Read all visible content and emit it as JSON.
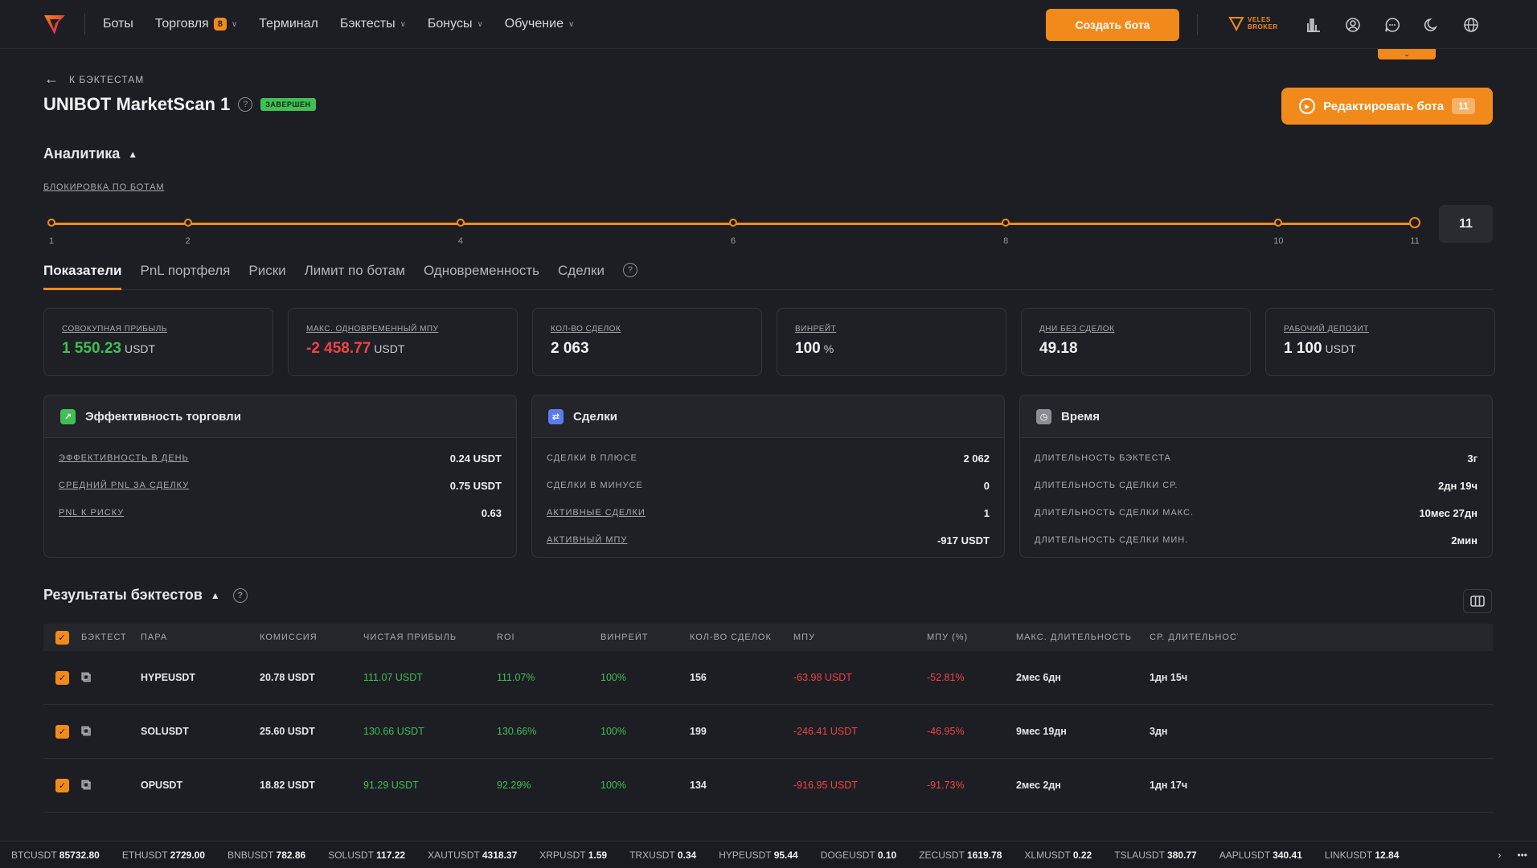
{
  "nav": {
    "items": [
      {
        "label": "Боты",
        "badge": "",
        "has_chevron": false
      },
      {
        "label": "Торговля",
        "badge": "8",
        "has_chevron": true
      },
      {
        "label": "Терминал",
        "badge": "",
        "has_chevron": false
      },
      {
        "label": "Бэктесты",
        "badge": "",
        "has_chevron": true
      },
      {
        "label": "Бонусы",
        "badge": "",
        "has_chevron": true
      },
      {
        "label": "Обучение",
        "badge": "",
        "has_chevron": true
      }
    ],
    "create_bot": "Создать бота",
    "broker_line1": "VELES",
    "broker_line2": "BROKER"
  },
  "header": {
    "back_label": "К БЭКТЕСТАМ",
    "title": "UNIBOT MarketScan 1",
    "status": "ЗАВЕРШЕН",
    "edit_button": "Редактировать бота",
    "edit_count": "11"
  },
  "analytics": {
    "title": "Аналитика",
    "block_link": "БЛОКИРОВКА ПО БОТАМ",
    "slider": {
      "min": 1,
      "max": 11,
      "value": 11,
      "ticks": [
        "1",
        "2",
        "4",
        "6",
        "8",
        "10",
        "11"
      ],
      "value_label": "11"
    }
  },
  "tabs": [
    {
      "label": "Показатели",
      "active": true
    },
    {
      "label": "PnL портфеля",
      "active": false
    },
    {
      "label": "Риски",
      "active": false
    },
    {
      "label": "Лимит по ботам",
      "active": false
    },
    {
      "label": "Одновременность",
      "active": false
    },
    {
      "label": "Сделки",
      "active": false
    }
  ],
  "stats": [
    {
      "label": "СОВОКУПНАЯ ПРИБЫЛЬ",
      "value": "1 550.23",
      "unit": "USDT",
      "tone": "pos"
    },
    {
      "label": "МАКС. ОДНОВРЕМЕННЫЙ МПУ",
      "value": "-2 458.77",
      "unit": "USDT",
      "tone": "neg"
    },
    {
      "label": "КОЛ-ВО СДЕЛОК",
      "value": "2 063",
      "unit": "",
      "tone": ""
    },
    {
      "label": "ВИНРЕЙТ",
      "value": "100",
      "unit": "%",
      "tone": ""
    },
    {
      "label": "ДНИ БЕЗ СДЕЛОК",
      "value": "49.18",
      "unit": "",
      "tone": ""
    },
    {
      "label": "РАБОЧИЙ ДЕПОЗИТ",
      "value": "1 100",
      "unit": "USDT",
      "tone": ""
    }
  ],
  "panels": {
    "efficiency": {
      "title": "Эффективность торговли",
      "accent": "#3fbf54",
      "rows": [
        {
          "label": "ЭФФЕКТИВНОСТЬ В ДЕНЬ",
          "value": "0.24 USDT",
          "tone": "pos",
          "underline": true
        },
        {
          "label": "СРЕДНИЙ PNL ЗА СДЕЛКУ",
          "value": "0.75 USDT",
          "tone": "pos",
          "underline": true
        },
        {
          "label": "PNL К РИСКУ",
          "value": "0.63",
          "tone": "",
          "underline": true
        }
      ]
    },
    "deals": {
      "title": "Сделки",
      "accent": "#5b7cf0",
      "rows": [
        {
          "label": "СДЕЛКИ В ПЛЮСЕ",
          "value": "2 062",
          "tone": "",
          "underline": false
        },
        {
          "label": "СДЕЛКИ В МИНУСЕ",
          "value": "0",
          "tone": "",
          "underline": false
        },
        {
          "label": "АКТИВНЫЕ СДЕЛКИ",
          "value": "1",
          "tone": "",
          "underline": true
        },
        {
          "label": "АКТИВНЫЙ МПУ",
          "value": "-917 USDT",
          "tone": "neg",
          "underline": true
        }
      ]
    },
    "time": {
      "title": "Время",
      "accent": "#8c8d94",
      "rows": [
        {
          "label": "ДЛИТЕЛЬНОСТЬ БЭКТЕСТА",
          "value": "3г",
          "tone": "",
          "underline": false
        },
        {
          "label": "ДЛИТЕЛЬНОСТЬ СДЕЛКИ СР.",
          "value": "2дн 19ч",
          "tone": "",
          "underline": false
        },
        {
          "label": "ДЛИТЕЛЬНОСТЬ СДЕЛКИ МАКС.",
          "value": "10мес 27дн",
          "tone": "",
          "underline": false
        },
        {
          "label": "ДЛИТЕЛЬНОСТЬ СДЕЛКИ МИН.",
          "value": "2мин",
          "tone": "",
          "underline": false
        }
      ]
    }
  },
  "results": {
    "title": "Результаты бэктестов",
    "columns": [
      "БЭКТЕСТ",
      "ПАРА",
      "КОМИССИЯ",
      "ЧИСТАЯ ПРИБЫЛЬ",
      "ROI",
      "ВИНРЕЙТ",
      "КОЛ-ВО СДЕЛОК",
      "МПУ",
      "МПУ (%)",
      "МАКС. ДЛИТЕЛЬНОСТЬ",
      "СР. ДЛИТЕЛЬНОСТЬ"
    ],
    "rows": [
      {
        "pair": "HYPEUSDT",
        "fee": "20.78 USDT",
        "profit": "111.07 USDT",
        "roi": "111.07%",
        "winrate": "100%",
        "deals": "156",
        "mpu": "-63.98 USDT",
        "mpu_pct": "-52.81%",
        "max_dur": "2мес 6дн",
        "avg_dur": "1дн 15ч"
      },
      {
        "pair": "SOLUSDT",
        "fee": "25.60 USDT",
        "profit": "130.66 USDT",
        "roi": "130.66%",
        "winrate": "100%",
        "deals": "199",
        "mpu": "-246.41 USDT",
        "mpu_pct": "-46.95%",
        "max_dur": "9мес 19дн",
        "avg_dur": "3дн"
      },
      {
        "pair": "OPUSDT",
        "fee": "18.82 USDT",
        "profit": "91.29 USDT",
        "roi": "92.29%",
        "winrate": "100%",
        "deals": "134",
        "mpu": "-916.95 USDT",
        "mpu_pct": "-91.73%",
        "max_dur": "2мес 2дн",
        "avg_dur": "1дн 17ч"
      }
    ]
  },
  "ticker": [
    {
      "sym": "BTCUSDT",
      "price": "85732.80"
    },
    {
      "sym": "ETHUSDT",
      "price": "2729.00"
    },
    {
      "sym": "BNBUSDT",
      "price": "782.86"
    },
    {
      "sym": "SOLUSDT",
      "price": "117.22"
    },
    {
      "sym": "XAUTUSDT",
      "price": "4318.37"
    },
    {
      "sym": "XRPUSDT",
      "price": "1.59"
    },
    {
      "sym": "TRXUSDT",
      "price": "0.34"
    },
    {
      "sym": "HYPEUSDT",
      "price": "95.44"
    },
    {
      "sym": "DOGEUSDT",
      "price": "0.10"
    },
    {
      "sym": "ZECUSDT",
      "price": "1619.78"
    },
    {
      "sym": "XLMUSDT",
      "price": "0.22"
    },
    {
      "sym": "TSLAUSDT",
      "price": "380.77"
    },
    {
      "sym": "AAPLUSDT",
      "price": "340.41"
    },
    {
      "sym": "LINKUSDT",
      "price": "12.84"
    }
  ],
  "icons": {
    "logo": "veles-logo",
    "top": [
      "chart-bars-icon",
      "user-circle-icon",
      "chat-icon",
      "moon-icon",
      "globe-icon"
    ]
  },
  "colors": {
    "accent": "#f28a1b",
    "positive": "#3fbf54",
    "negative": "#ef4444",
    "background": "#1d1e23"
  }
}
